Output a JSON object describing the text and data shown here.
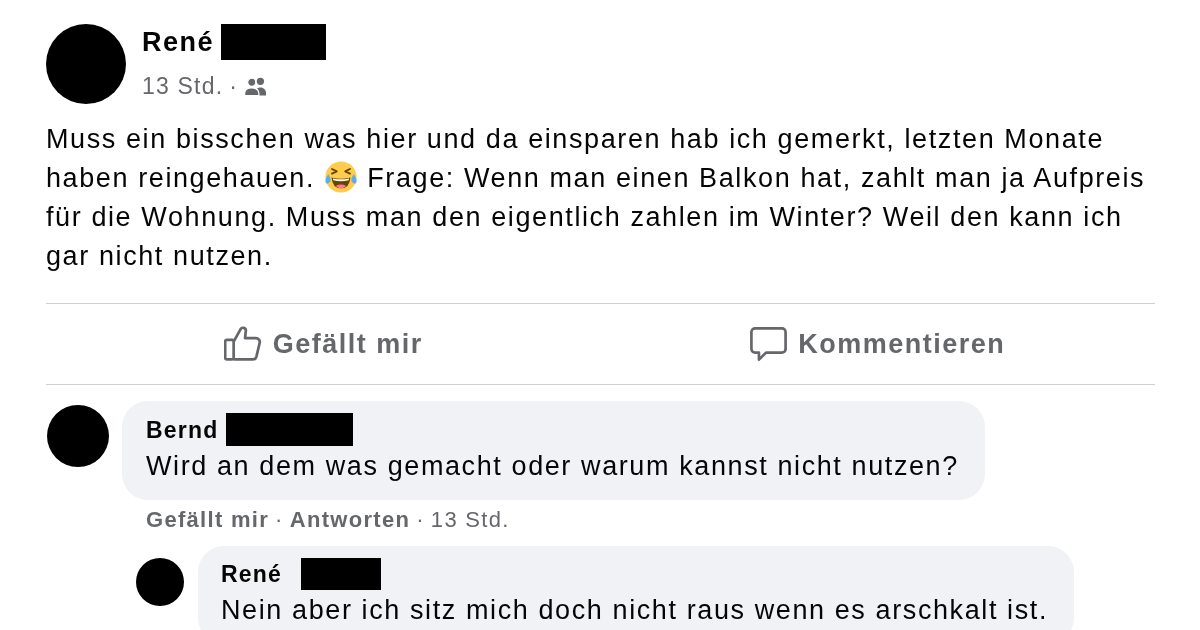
{
  "post": {
    "author": {
      "name": "René",
      "redacted": true
    },
    "time": "13 Std.",
    "separator": "·",
    "body": [
      {
        "kind": "text",
        "text": "Muss ein bisschen was hier und da einsparen hab ich gemerkt, letzten Monate haben reingehauen."
      },
      {
        "kind": "emoji"
      },
      {
        "kind": "text",
        "text": "Frage: Wenn man einen Balkon hat, zahlt man ja Aufpreis für die Wohnung. Muss man den eigentlich zahlen im Winter? Weil den kann ich gar nicht nutzen."
      }
    ],
    "actions": [
      {
        "kind": "like",
        "label": "Gefällt mir"
      },
      {
        "kind": "comment",
        "label": "Kommentieren"
      }
    ]
  },
  "comments": [
    {
      "author": {
        "name": "Bernd",
        "redacted": true
      },
      "text": "Wird an dem was gemacht oder warum kannst nicht nutzen?",
      "actions": [
        {
          "label": "Gefällt mir"
        },
        {
          "label": "Antworten"
        }
      ],
      "separator": "·",
      "time": "13 Std.",
      "replies": [
        {
          "author": {
            "name": "René",
            "redacted": true
          },
          "text": "Nein aber ich sitz mich doch nicht raus wenn es arschkalt ist."
        }
      ]
    }
  ]
}
